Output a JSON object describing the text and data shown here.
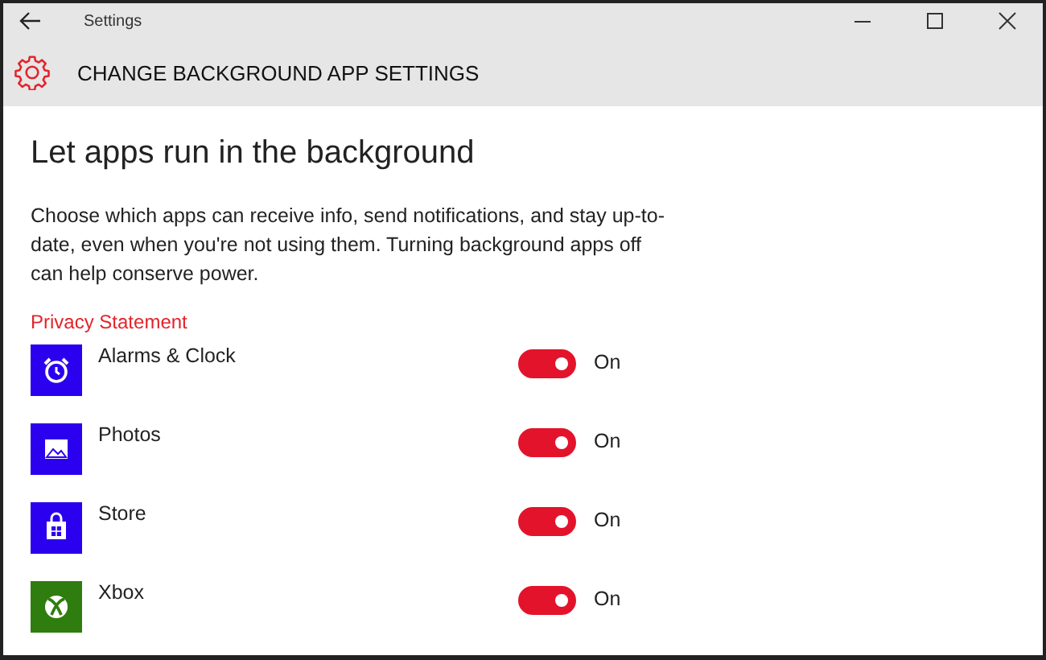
{
  "window": {
    "title": "Settings"
  },
  "header": {
    "title": "CHANGE BACKGROUND APP SETTINGS"
  },
  "heading": "Let apps run in the background",
  "description": "Choose which apps can receive info, send notifications, and stay up-to-date, even when you're not using them. Turning background apps off can help conserve power.",
  "link": "Privacy Statement",
  "apps": [
    {
      "name": "Alarms & Clock",
      "kind": "alarm",
      "color": "#2b00ee",
      "on": true,
      "state_label": "On"
    },
    {
      "name": "Photos",
      "kind": "photos",
      "color": "#2b00ee",
      "on": true,
      "state_label": "On"
    },
    {
      "name": "Store",
      "kind": "store",
      "color": "#2b00ee",
      "on": true,
      "state_label": "On"
    },
    {
      "name": "Xbox",
      "kind": "xbox",
      "color": "#2f7d0e",
      "on": true,
      "state_label": "On"
    }
  ]
}
